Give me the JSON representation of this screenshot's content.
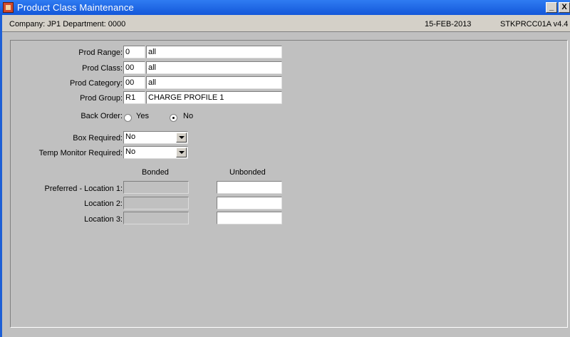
{
  "window": {
    "title": "Product Class Maintenance",
    "minimize_label": "_",
    "close_label": "X"
  },
  "infobar": {
    "company": "Company:  JP1   Department:  0000",
    "date": "15-FEB-2013",
    "program": "STKPRCC01A  v4.4"
  },
  "form": {
    "prod_range": {
      "label": "Prod Range:",
      "code": "0",
      "desc": "all"
    },
    "prod_class": {
      "label": "Prod Class:",
      "code": "00",
      "desc": "all"
    },
    "prod_category": {
      "label": "Prod Category:",
      "code": "00",
      "desc": "all"
    },
    "prod_group": {
      "label": "Prod Group:",
      "code": "R1",
      "desc": "CHARGE PROFILE 1"
    },
    "back_order": {
      "label": "Back Order:",
      "yes": "Yes",
      "no": "No",
      "selected": "No"
    },
    "box_required": {
      "label": "Box Required:",
      "value": "No"
    },
    "temp_monitor": {
      "label": "Temp Monitor Required:",
      "value": "No"
    },
    "locations": {
      "bonded_header": "Bonded",
      "unbonded_header": "Unbonded",
      "loc1_label": "Preferred - Location 1:",
      "loc2_label": "Location 2:",
      "loc3_label": "Location 3:"
    }
  }
}
